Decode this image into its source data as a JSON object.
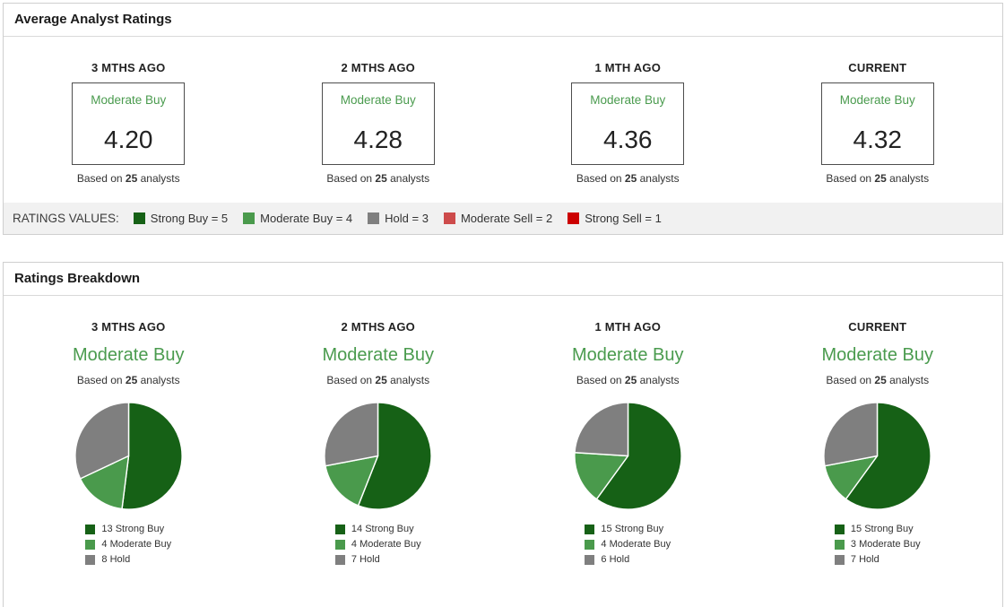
{
  "colors": {
    "strong_buy": "#166116",
    "moderate_buy": "#4a9a4c",
    "hold": "#7f7f7f",
    "moderate_sell": "#cd4b4b",
    "strong_sell": "#cc0000",
    "rating_text_green": "#4a9b4e"
  },
  "average_panel": {
    "title": "Average Analyst Ratings",
    "columns": [
      {
        "period": "3 MTHS AGO",
        "rating": "Moderate Buy",
        "value": "4.20",
        "based_prefix": "Based on ",
        "analysts": "25",
        "based_suffix": " analysts"
      },
      {
        "period": "2 MTHS AGO",
        "rating": "Moderate Buy",
        "value": "4.28",
        "based_prefix": "Based on ",
        "analysts": "25",
        "based_suffix": " analysts"
      },
      {
        "period": "1 MTH AGO",
        "rating": "Moderate Buy",
        "value": "4.36",
        "based_prefix": "Based on ",
        "analysts": "25",
        "based_suffix": " analysts"
      },
      {
        "period": "CURRENT",
        "rating": "Moderate Buy",
        "value": "4.32",
        "based_prefix": "Based on ",
        "analysts": "25",
        "based_suffix": " analysts"
      }
    ],
    "values_bar": {
      "label": "RATINGS VALUES:",
      "items": [
        {
          "label": "Strong Buy = 5",
          "color": "#166116"
        },
        {
          "label": "Moderate Buy = 4",
          "color": "#4a9a4c"
        },
        {
          "label": "Hold = 3",
          "color": "#7f7f7f"
        },
        {
          "label": "Moderate Sell = 2",
          "color": "#cd4b4b"
        },
        {
          "label": "Strong Sell = 1",
          "color": "#cc0000"
        }
      ]
    }
  },
  "breakdown_panel": {
    "title": "Ratings Breakdown",
    "columns": [
      {
        "period": "3 MTHS AGO",
        "rating": "Moderate Buy",
        "based_prefix": "Based on ",
        "analysts": "25",
        "based_suffix": " analysts",
        "legend": [
          {
            "text": "13 Strong Buy",
            "color": "#166116"
          },
          {
            "text": "4 Moderate Buy",
            "color": "#4a9a4c"
          },
          {
            "text": "8 Hold",
            "color": "#7f7f7f"
          }
        ]
      },
      {
        "period": "2 MTHS AGO",
        "rating": "Moderate Buy",
        "based_prefix": "Based on ",
        "analysts": "25",
        "based_suffix": " analysts",
        "legend": [
          {
            "text": "14 Strong Buy",
            "color": "#166116"
          },
          {
            "text": "4 Moderate Buy",
            "color": "#4a9a4c"
          },
          {
            "text": "7 Hold",
            "color": "#7f7f7f"
          }
        ]
      },
      {
        "period": "1 MTH AGO",
        "rating": "Moderate Buy",
        "based_prefix": "Based on ",
        "analysts": "25",
        "based_suffix": " analysts",
        "legend": [
          {
            "text": "15 Strong Buy",
            "color": "#166116"
          },
          {
            "text": "4 Moderate Buy",
            "color": "#4a9a4c"
          },
          {
            "text": "6 Hold",
            "color": "#7f7f7f"
          }
        ]
      },
      {
        "period": "CURRENT",
        "rating": "Moderate Buy",
        "based_prefix": "Based on ",
        "analysts": "25",
        "based_suffix": " analysts",
        "legend": [
          {
            "text": "15 Strong Buy",
            "color": "#166116"
          },
          {
            "text": "3 Moderate Buy",
            "color": "#4a9a4c"
          },
          {
            "text": "7 Hold",
            "color": "#7f7f7f"
          }
        ]
      }
    ]
  },
  "chart_data": [
    {
      "type": "table",
      "title": "Average Analyst Ratings",
      "categories": [
        "3 MTHS AGO",
        "2 MTHS AGO",
        "1 MTH AGO",
        "CURRENT"
      ],
      "values": [
        4.2,
        4.28,
        4.36,
        4.32
      ],
      "rating_label": "Moderate Buy",
      "analysts": 25,
      "scale": "Strong Buy = 5, Moderate Buy = 4, Hold = 3, Moderate Sell = 2, Strong Sell = 1"
    },
    {
      "type": "pie",
      "title": "3 MTHS AGO",
      "subtitle": "Moderate Buy",
      "note": "Based on 25 analysts",
      "labels": [
        "Strong Buy",
        "Moderate Buy",
        "Hold"
      ],
      "values": [
        13,
        4,
        8
      ],
      "colors": [
        "#166116",
        "#4a9a4c",
        "#7f7f7f"
      ],
      "legend_position": "bottom"
    },
    {
      "type": "pie",
      "title": "2 MTHS AGO",
      "subtitle": "Moderate Buy",
      "note": "Based on 25 analysts",
      "labels": [
        "Strong Buy",
        "Moderate Buy",
        "Hold"
      ],
      "values": [
        14,
        4,
        7
      ],
      "colors": [
        "#166116",
        "#4a9a4c",
        "#7f7f7f"
      ],
      "legend_position": "bottom"
    },
    {
      "type": "pie",
      "title": "1 MTH AGO",
      "subtitle": "Moderate Buy",
      "note": "Based on 25 analysts",
      "labels": [
        "Strong Buy",
        "Moderate Buy",
        "Hold"
      ],
      "values": [
        15,
        4,
        6
      ],
      "colors": [
        "#166116",
        "#4a9a4c",
        "#7f7f7f"
      ],
      "legend_position": "bottom"
    },
    {
      "type": "pie",
      "title": "CURRENT",
      "subtitle": "Moderate Buy",
      "note": "Based on 25 analysts",
      "labels": [
        "Strong Buy",
        "Moderate Buy",
        "Hold"
      ],
      "values": [
        15,
        3,
        7
      ],
      "colors": [
        "#166116",
        "#4a9a4c",
        "#7f7f7f"
      ],
      "legend_position": "bottom"
    }
  ]
}
